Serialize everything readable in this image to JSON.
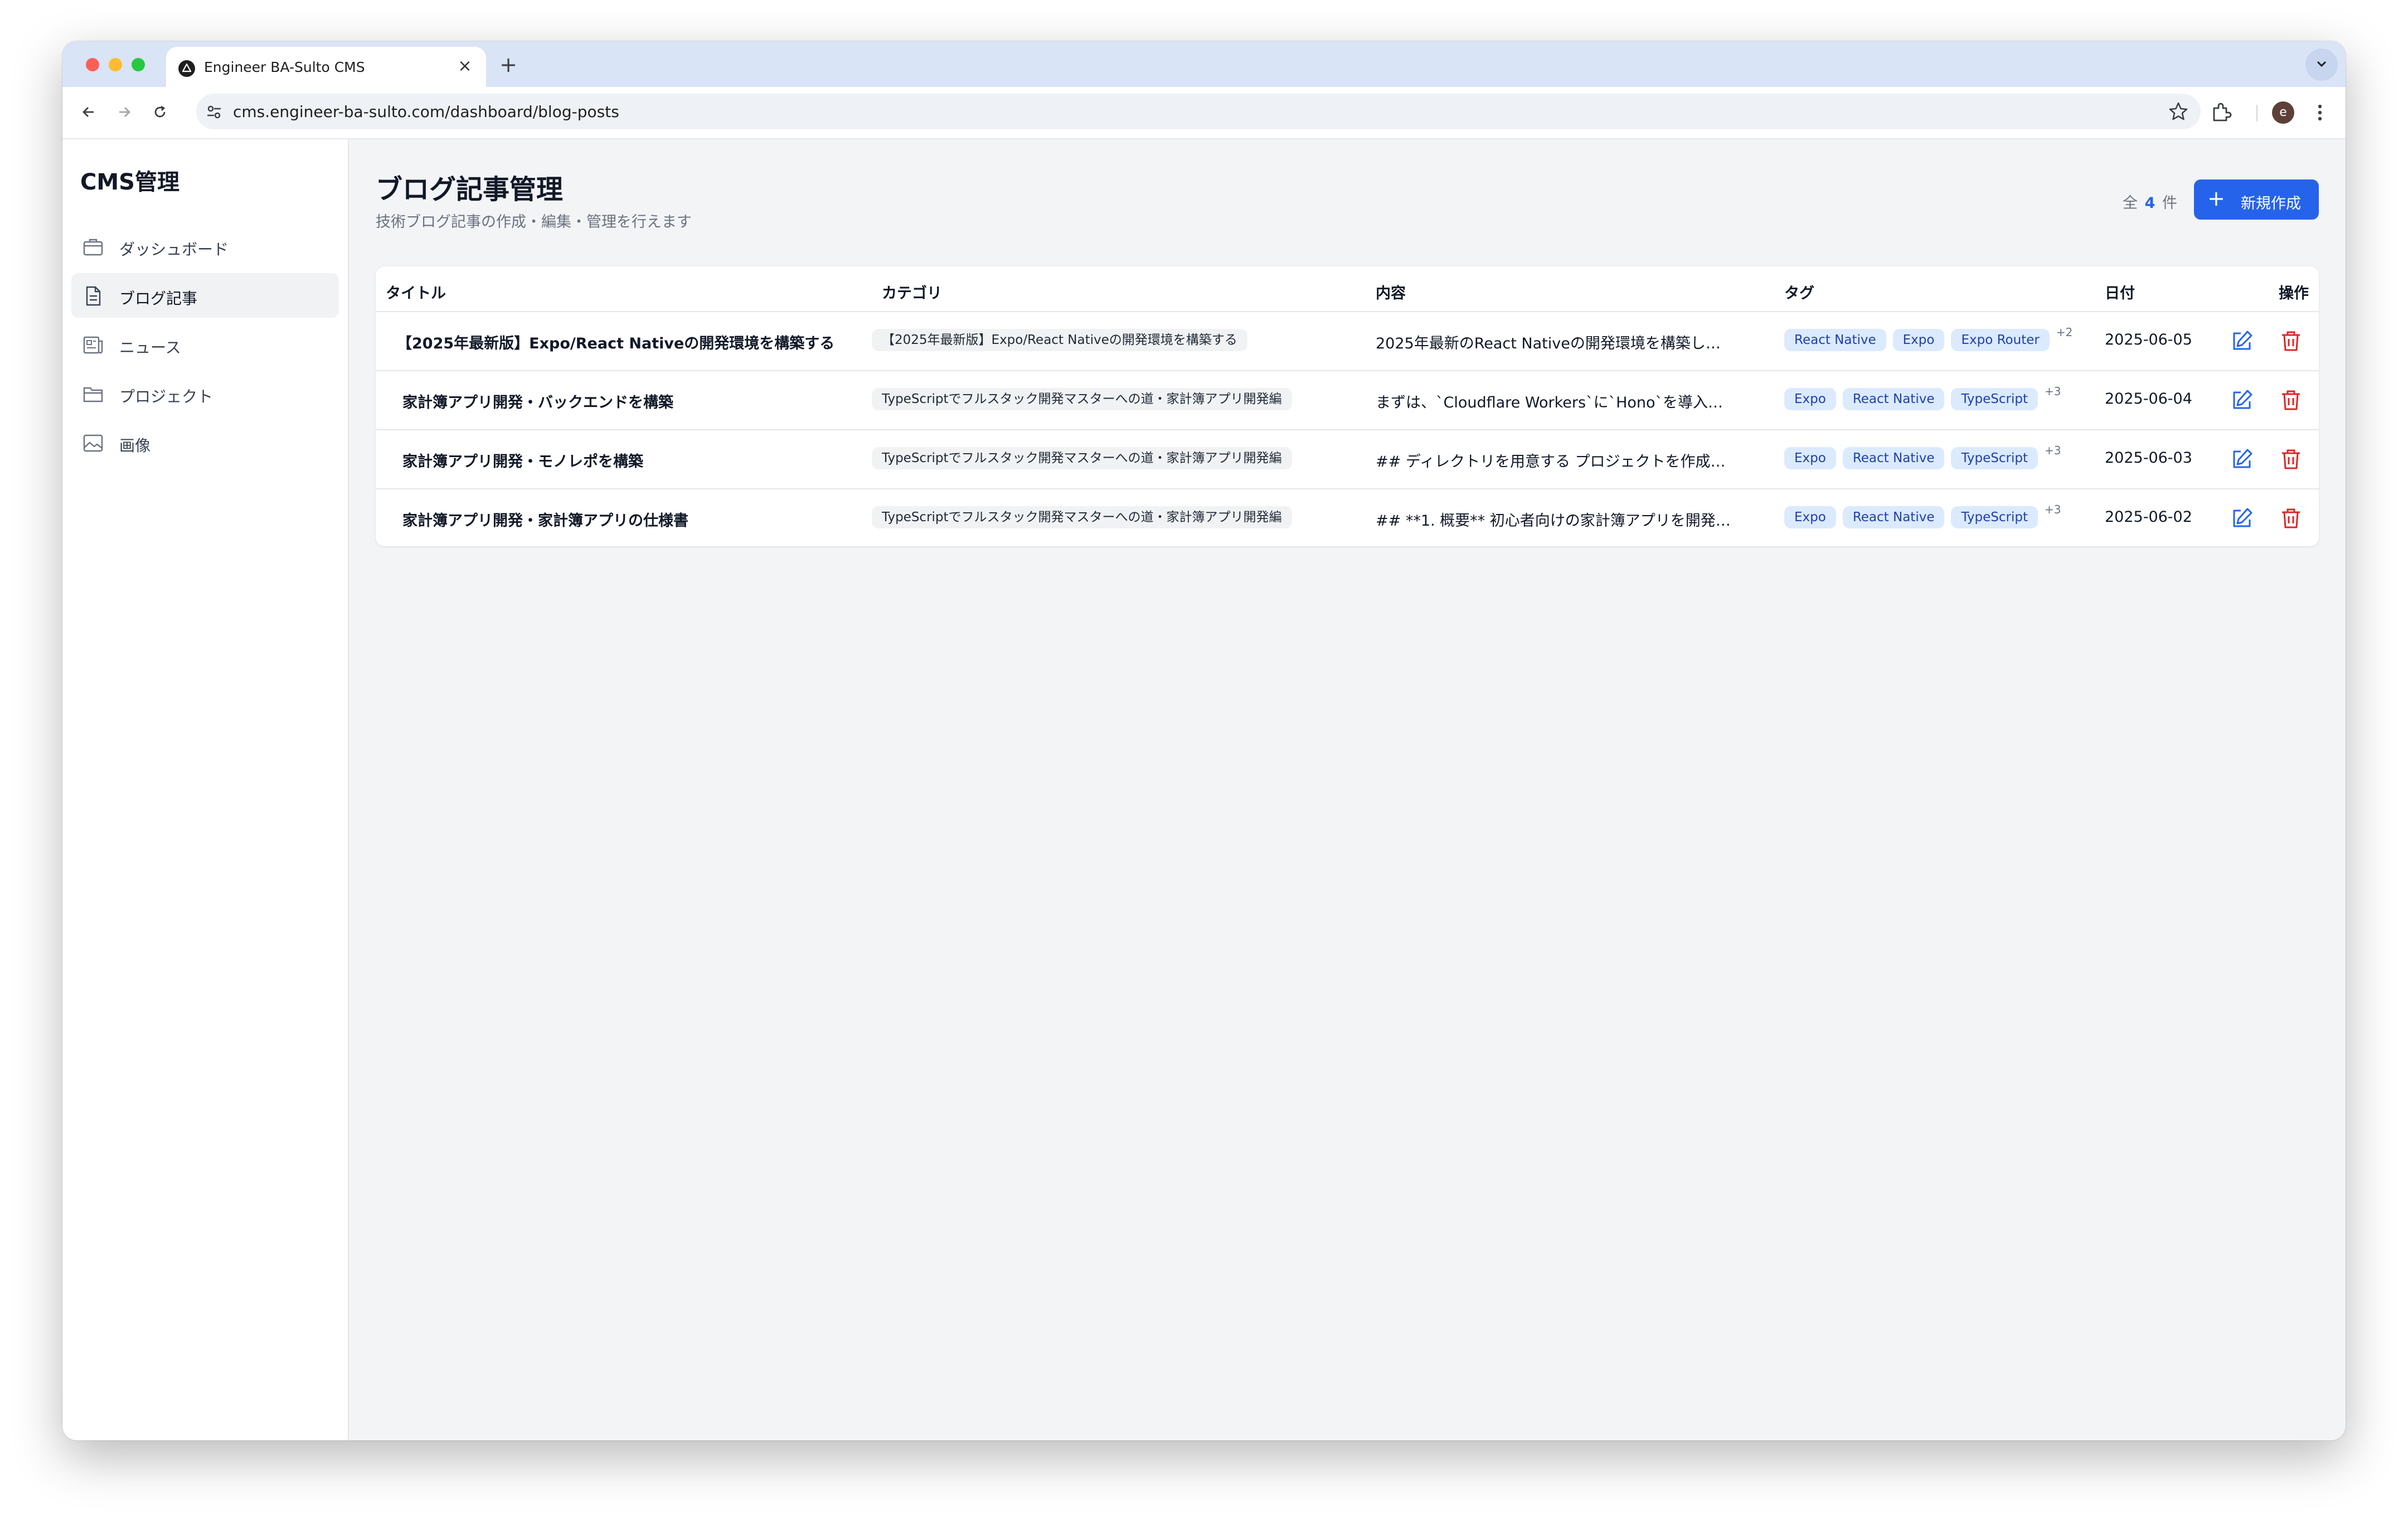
{
  "browser": {
    "tab_title": "Engineer BA-Sulto CMS",
    "tab_close": "×",
    "new_tab": "+",
    "url": "cms.engineer-ba-sulto.com/dashboard/blog-posts",
    "avatar_letter": "e",
    "colors": {
      "close": "#ff5f57",
      "minimize": "#febc2e",
      "maximize": "#28c840"
    }
  },
  "sidebar": {
    "brand": "CMS管理",
    "items": [
      {
        "label": "ダッシュボード",
        "icon": "briefcase-icon",
        "active": false
      },
      {
        "label": "ブログ記事",
        "icon": "document-icon",
        "active": true
      },
      {
        "label": "ニュース",
        "icon": "newspaper-icon",
        "active": false
      },
      {
        "label": "プロジェクト",
        "icon": "folder-icon",
        "active": false
      },
      {
        "label": "画像",
        "icon": "image-icon",
        "active": false
      }
    ]
  },
  "header": {
    "title": "ブログ記事管理",
    "subtitle": "技術ブログ記事の作成・編集・管理を行えます",
    "count_prefix": "全",
    "count_value": "4",
    "count_suffix": "件",
    "new_button_icon": "+",
    "new_button_label": "新規作成",
    "accent_color": "#2563eb"
  },
  "table": {
    "columns": [
      "タイトル",
      "カテゴリ",
      "内容",
      "タグ",
      "日付",
      "操作"
    ],
    "rows": [
      {
        "title": "【2025年最新版】Expo/React Nativeの開発環境を構築する",
        "category": "【2025年最新版】Expo/React Nativeの開発環境を構築する",
        "content": "2025年最新のReact Nativeの開発環境を構築し…",
        "tags": [
          "React Native",
          "Expo",
          "Expo Router"
        ],
        "more": "+2",
        "date": "2025-06-05"
      },
      {
        "title": "家計簿アプリ開発・バックエンドを構築",
        "category": "TypeScriptでフルスタック開発マスターへの道・家計簿アプリ開発編",
        "content": "まずは、`Cloudflare Workers`に`Hono`を導入…",
        "tags": [
          "Expo",
          "React Native",
          "TypeScript"
        ],
        "more": "+3",
        "date": "2025-06-04"
      },
      {
        "title": "家計簿アプリ開発・モノレポを構築",
        "category": "TypeScriptでフルスタック開発マスターへの道・家計簿アプリ開発編",
        "content": "## ディレクトリを用意する プロジェクトを作成…",
        "tags": [
          "Expo",
          "React Native",
          "TypeScript"
        ],
        "more": "+3",
        "date": "2025-06-03"
      },
      {
        "title": "家計簿アプリ開発・家計簿アプリの仕様書",
        "category": "TypeScriptでフルスタック開発マスターへの道・家計簿アプリ開発編",
        "content": "## **1. 概要** 初心者向けの家計簿アプリを開発…",
        "tags": [
          "Expo",
          "React Native",
          "TypeScript"
        ],
        "more": "+3",
        "date": "2025-06-02"
      }
    ]
  }
}
